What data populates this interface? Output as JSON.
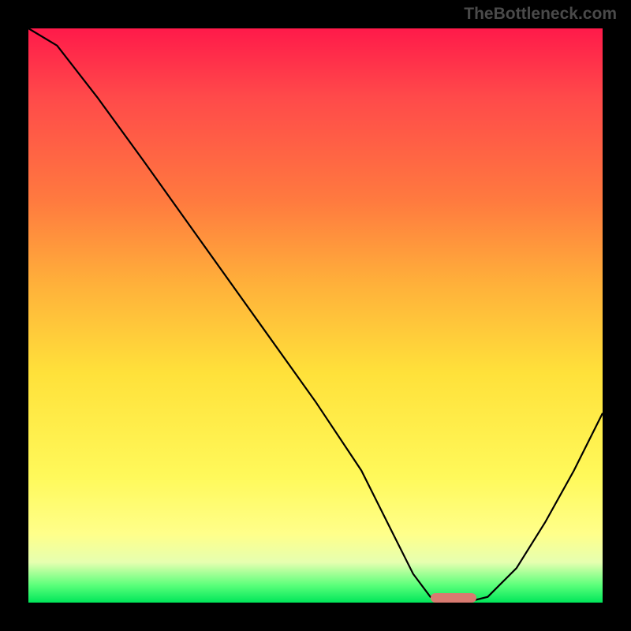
{
  "watermark": "TheBottleneck.com",
  "chart_data": {
    "type": "line",
    "title": "",
    "xlabel": "",
    "ylabel": "",
    "xlim": [
      0,
      100
    ],
    "ylim": [
      0,
      100
    ],
    "x": [
      0,
      5,
      12,
      20,
      30,
      40,
      50,
      58,
      63,
      67,
      70,
      73,
      76,
      80,
      85,
      90,
      95,
      100
    ],
    "values": [
      100,
      97,
      88,
      77,
      63,
      49,
      35,
      23,
      13,
      5,
      1,
      0,
      0,
      1,
      6,
      14,
      23,
      33
    ],
    "highlight_range_x": [
      70,
      78
    ],
    "annotations": [
      "TheBottleneck.com"
    ]
  },
  "colors": {
    "curve": "#000000",
    "marker": "#d87a70",
    "gradient_top": "#ff1a4a",
    "gradient_bottom": "#00e65a"
  }
}
